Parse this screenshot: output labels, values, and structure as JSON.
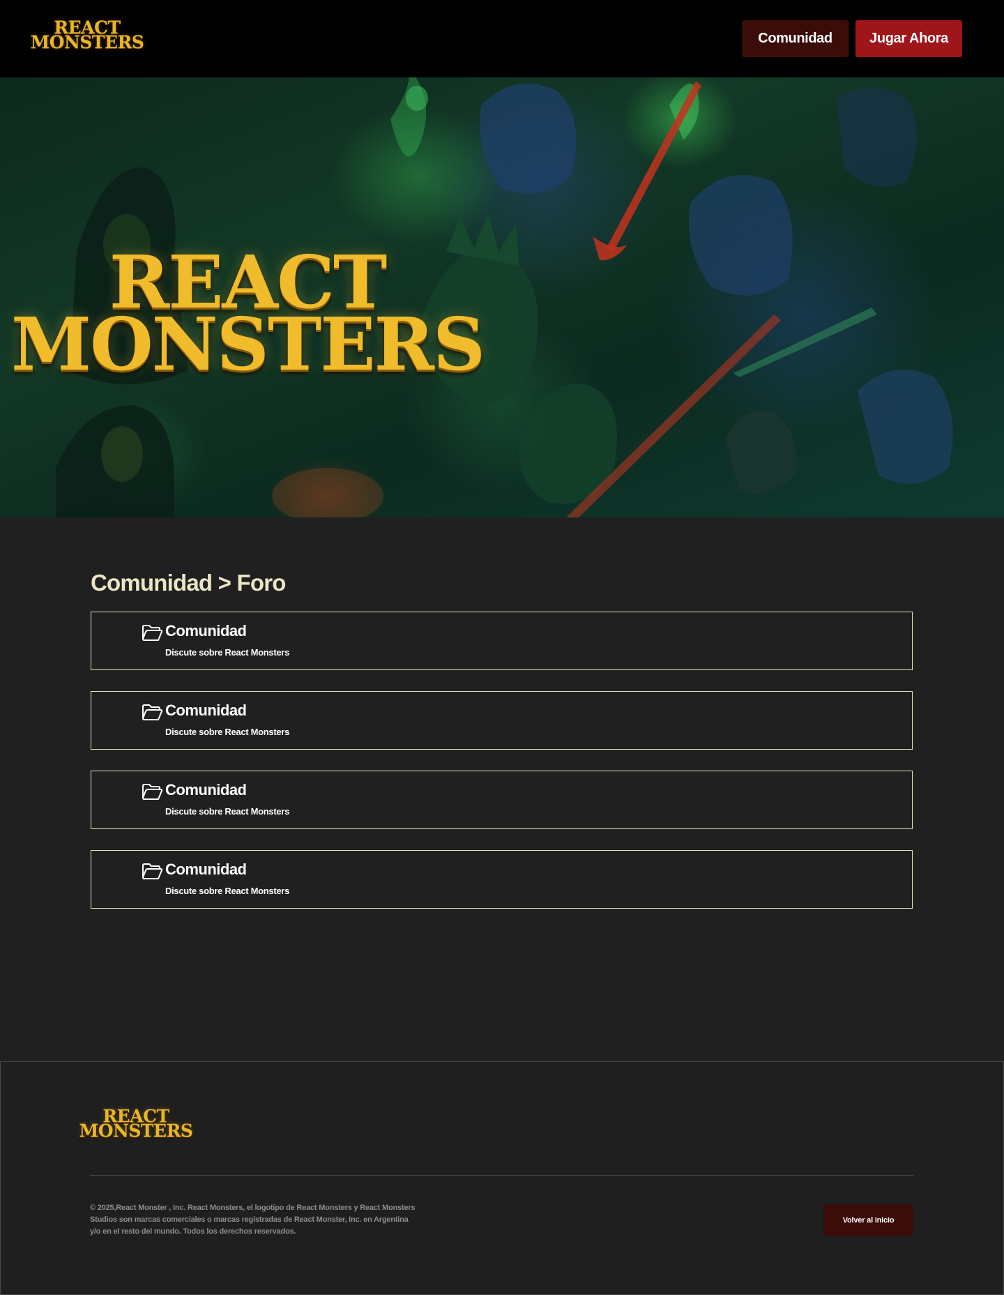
{
  "brand": {
    "logo_line1": "REACT",
    "logo_line2": "MONSTERS"
  },
  "header": {
    "community_button": "Comunidad",
    "play_button": "Jugar Ahora"
  },
  "main": {
    "title": "Comunidad > Foro",
    "forums": [
      {
        "icon": "folder-open-icon",
        "title": "Comunidad",
        "description": "Discute sobre React Monsters"
      },
      {
        "icon": "folder-open-icon",
        "title": "Comunidad",
        "description": "Discute sobre React Monsters"
      },
      {
        "icon": "folder-open-icon",
        "title": "Comunidad",
        "description": "Discute sobre React Monsters"
      },
      {
        "icon": "folder-open-icon",
        "title": "Comunidad",
        "description": "Discute sobre React Monsters"
      }
    ]
  },
  "footer": {
    "legal": "© 2025,React Monster , Inc. React Monsters, el logotipo de React Monsters y React Monsters Studios son marcas comerciales o marcas registradas de React Monster, Inc. en Argentina y/o en el resto del mundo. Todos los derechos reservados.",
    "back_button": "Volver al inicio"
  },
  "colors": {
    "header_bg": "#000000",
    "page_bg": "#202020",
    "community_button_bg": "#3a0d08",
    "play_button_bg": "#9e151a",
    "card_border": "#e9e3b4",
    "title_color": "#ece6c6",
    "logo_gold": "#f0bc2c"
  }
}
